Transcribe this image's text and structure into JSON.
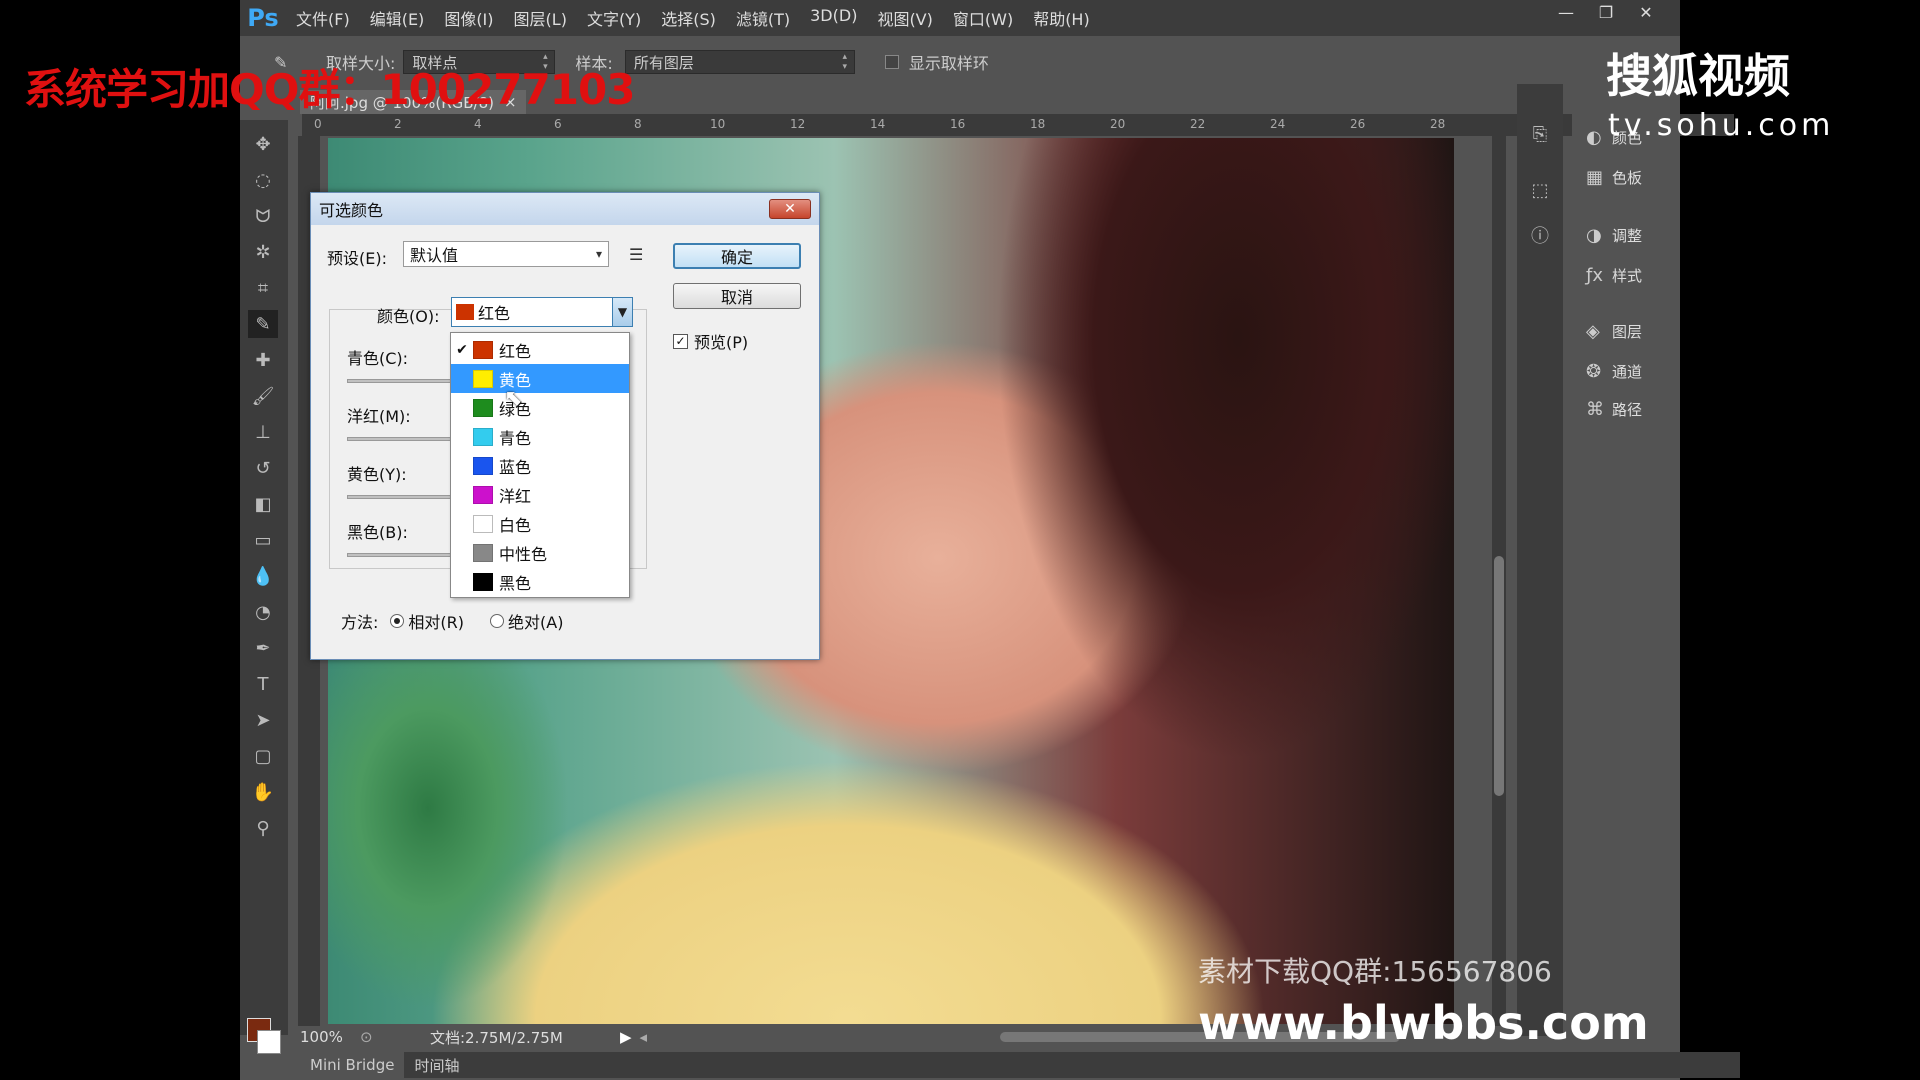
{
  "app": {
    "logo": "Ps",
    "menu": [
      "文件(F)",
      "编辑(E)",
      "图像(I)",
      "图层(L)",
      "文字(Y)",
      "选择(S)",
      "滤镜(T)",
      "3D(D)",
      "视图(V)",
      "窗口(W)",
      "帮助(H)"
    ],
    "window_controls": [
      "—",
      "❐",
      "✕"
    ]
  },
  "options": {
    "sample_size_label": "取样大小:",
    "sample_size_value": "取样点",
    "sample_label": "样本:",
    "sample_value": "所有图层",
    "show_ring_label": "显示取样环"
  },
  "document": {
    "tab_title": "阿阿.jpg @ 100%(RGB/8)",
    "tab_close": "×",
    "ruler_ticks": [
      "0",
      "2",
      "4",
      "6",
      "8",
      "10",
      "12",
      "14",
      "16",
      "18",
      "20",
      "22",
      "24",
      "26",
      "28"
    ],
    "zoom": "100%",
    "doc_info": "文档:2.75M/2.75M"
  },
  "bottom_tabs": [
    "Mini Bridge",
    "时间轴"
  ],
  "panels": [
    {
      "icon": "color-icon",
      "label": "颜色"
    },
    {
      "icon": "swatches-icon",
      "label": "色板"
    },
    {
      "icon": "adjustments-icon",
      "label": "调整"
    },
    {
      "icon": "styles-icon",
      "label": "样式"
    },
    {
      "icon": "layers-icon",
      "label": "图层"
    },
    {
      "icon": "channels-icon",
      "label": "通道"
    },
    {
      "icon": "paths-icon",
      "label": "路径"
    }
  ],
  "dialog": {
    "title": "可选颜色",
    "close": "✕",
    "preset_label": "预设(E):",
    "preset_value": "默认值",
    "ok": "确定",
    "cancel": "取消",
    "preview_label": "预览(P)",
    "preview_checked": true,
    "colors_label": "颜色(O):",
    "colors_value": "红色",
    "sliders": [
      "青色(C):",
      "洋红(M):",
      "黄色(Y):",
      "黑色(B):"
    ],
    "method_label": "方法:",
    "method_relative": "相对(R)",
    "method_absolute": "绝对(A)",
    "method_selected": "relative"
  },
  "dropdown": {
    "items": [
      {
        "label": "红色",
        "color": "#cc3300",
        "checked": true
      },
      {
        "label": "黄色",
        "color": "#ffee00",
        "highlighted": true
      },
      {
        "label": "绿色",
        "color": "#1e8c1e"
      },
      {
        "label": "青色",
        "color": "#33ccee"
      },
      {
        "label": "蓝色",
        "color": "#1a55ee"
      },
      {
        "label": "洋红",
        "color": "#cc11cc"
      },
      {
        "label": "白色",
        "color": "#ffffff"
      },
      {
        "label": "中性色",
        "color": "#888888"
      },
      {
        "label": "黑色",
        "color": "#000000"
      }
    ]
  },
  "overlays": {
    "qq_group": "系统学习加QQ群：100277103",
    "sohu_logo": "搜狐视频",
    "sohu_url": "tv.sohu.com",
    "material_qq": "素材下载QQ群:156567806",
    "site": "www.blwbbs.com"
  },
  "colors": {
    "accent": "#3399ff",
    "foreground_swatch": "#7a2a10",
    "background_swatch": "#ffffff"
  }
}
